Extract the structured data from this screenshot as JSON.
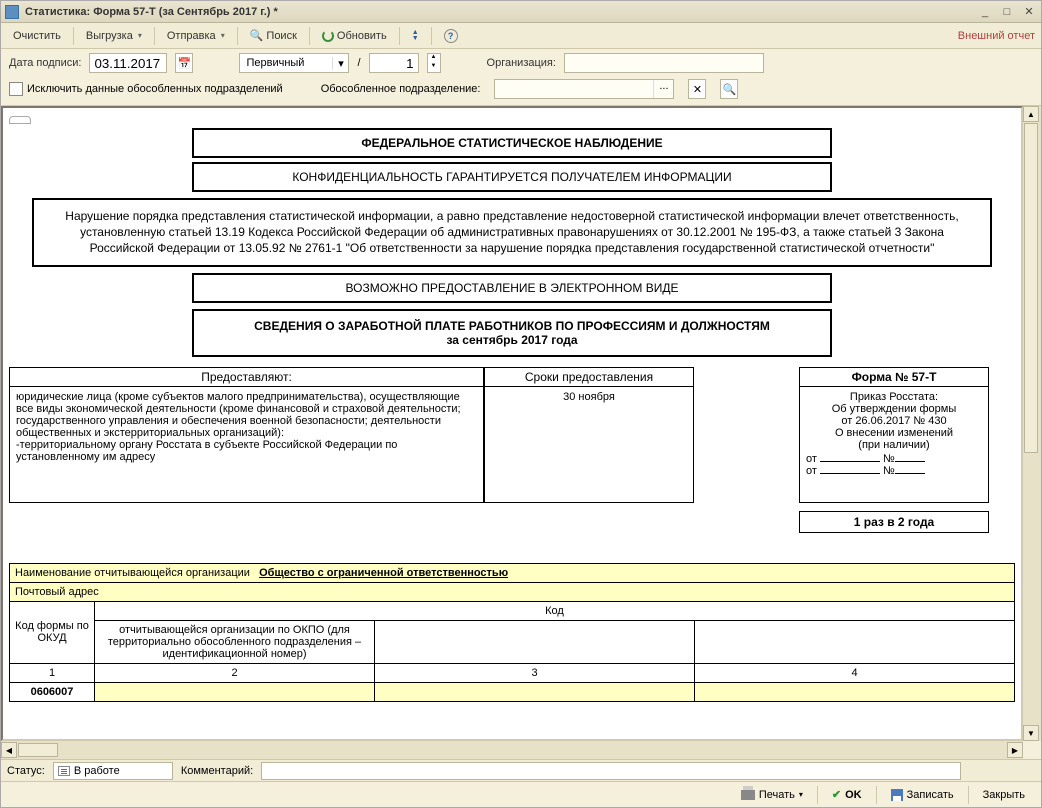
{
  "titlebar": {
    "title": "Статистика: Форма 57-Т (за Сентябрь 2017 г.) *"
  },
  "toolbar": {
    "clear": "Очистить",
    "export": "Выгрузка",
    "send": "Отправка",
    "search": "Поиск",
    "refresh": "Обновить",
    "external_report": "Внешний отчет"
  },
  "params": {
    "date_label": "Дата подписи:",
    "date_value": "03.11.2017",
    "report_type": "Первичный",
    "separator": "/",
    "number": "1",
    "org_label": "Организация:",
    "org_value": "",
    "exclude_label": "Исключить данные обособленных подразделений",
    "subdiv_label": "Обособленное подразделение:",
    "subdiv_value": ""
  },
  "doc": {
    "header1": "ФЕДЕРАЛЬНОЕ СТАТИСТИЧЕСКОЕ НАБЛЮДЕНИЕ",
    "header2": "КОНФИДЕНЦИАЛЬНОСТЬ ГАРАНТИРУЕТСЯ ПОЛУЧАТЕЛЕМ ИНФОРМАЦИИ",
    "legal_text": "Нарушение порядка представления статистической информации, а равно представление недостоверной статистической информации влечет ответственность, установленную статьей 13.19 Кодекса Российской Федерации об административных правонарушениях от 30.12.2001 № 195-ФЗ, а также статьей 3 Закона Российской Федерации от 13.05.92 № 2761-1 \"Об ответственности за нарушение порядка представления государственной статистической отчетности\"",
    "electronic": "ВОЗМОЖНО ПРЕДОСТАВЛЕНИЕ В ЭЛЕКТРОННОМ ВИДЕ",
    "form_title": "СВЕДЕНИЯ О ЗАРАБОТНОЙ ПЛАТЕ РАБОТНИКОВ ПО ПРОФЕССИЯМ И ДОЛЖНОСТЯМ",
    "form_period": "за сентябрь 2017 года",
    "col_provide": "Предоставляют:",
    "col_deadline": "Сроки предоставления",
    "provide_text": "юридические лица (кроме субъектов малого предпринимательства), осуществляющие все виды экономической деятельности (кроме финансовой и страховой деятельности; государственного управления и обеспечения военной безопасности; деятельности общественных и экстерриториальных организаций):\n  -территориальному органу Росстата в субъекте Российской Федерации по установленному им адресу",
    "deadline_text": "30 ноября",
    "form_label": "Форма № 57-Т",
    "order_text": "Приказ Росстата:\nОб утверждении формы\nот 26.06.2017 № 430\nО внесении изменений\n(при наличии)",
    "from_label": "от",
    "num_label": "№",
    "frequency": "1 раз в 2 года",
    "org_name_label": "Наименование отчитывающейся организации",
    "org_name_value": "Общество с ограниченной ответственностью",
    "postal_label": "Почтовый адрес",
    "code_label": "Код",
    "okud_label": "Код формы по ОКУД",
    "okpo_label": "отчитывающейся организации по ОКПО (для территориально обособленного подразделения – идентификационной номер)",
    "col1": "1",
    "col2": "2",
    "col3": "3",
    "col4": "4",
    "okud_value": "0606007"
  },
  "statusbar": {
    "status_label": "Статус:",
    "status_value": "В работе",
    "comment_label": "Комментарий:"
  },
  "footer": {
    "print": "Печать",
    "ok": "OK",
    "save": "Записать",
    "close": "Закрыть"
  }
}
